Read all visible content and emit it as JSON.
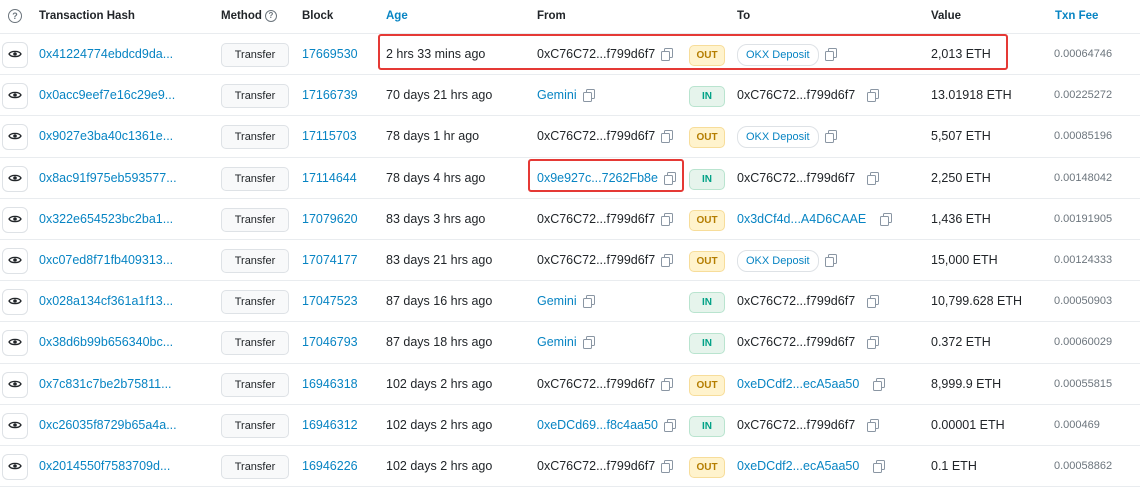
{
  "header": {
    "columns": {
      "hash": "Transaction Hash",
      "method": "Method",
      "block": "Block",
      "age": "Age",
      "from": "From",
      "to": "To",
      "value": "Value",
      "fee": "Txn Fee"
    },
    "help_glyph": "?"
  },
  "icons": {
    "view": "eye-icon",
    "copy": "copy-icon",
    "help": "question-circle-icon"
  },
  "colors": {
    "link": "#0784c3",
    "out": "#b47d00",
    "in": "#00a186",
    "highlight": "#e53935"
  },
  "rows": [
    {
      "hash": "0x41224774ebdcd9da...",
      "method": "Transfer",
      "block": "17669530",
      "age": "2 hrs 33 mins ago",
      "from": "0xC76C72...f799d6f7",
      "from_link": false,
      "dir": "OUT",
      "to": "OKX Deposit",
      "to_type": "pill",
      "value": "2,013 ETH",
      "fee": "0.00064746"
    },
    {
      "hash": "0x0acc9eef7e16c29e9...",
      "method": "Transfer",
      "block": "17166739",
      "age": "70 days 21 hrs ago",
      "from": "Gemini",
      "from_link": true,
      "dir": "IN",
      "to": "0xC76C72...f799d6f7",
      "to_type": "plain",
      "value": "13.01918 ETH",
      "fee": "0.00225272"
    },
    {
      "hash": "0x9027e3ba40c1361e...",
      "method": "Transfer",
      "block": "17115703",
      "age": "78 days 1 hr ago",
      "from": "0xC76C72...f799d6f7",
      "from_link": false,
      "dir": "OUT",
      "to": "OKX Deposit",
      "to_type": "pill",
      "value": "5,507 ETH",
      "fee": "0.00085196"
    },
    {
      "hash": "0x8ac91f975eb593577...",
      "method": "Transfer",
      "block": "17114644",
      "age": "78 days 4 hrs ago",
      "from": "0x9e927c...7262Fb8e",
      "from_link": true,
      "dir": "IN",
      "to": "0xC76C72...f799d6f7",
      "to_type": "plain",
      "value": "2,250 ETH",
      "fee": "0.00148042"
    },
    {
      "hash": "0x322e654523bc2ba1...",
      "method": "Transfer",
      "block": "17079620",
      "age": "83 days 3 hrs ago",
      "from": "0xC76C72...f799d6f7",
      "from_link": false,
      "dir": "OUT",
      "to": "0x3dCf4d...A4D6CAAE",
      "to_type": "link",
      "value": "1,436 ETH",
      "fee": "0.00191905"
    },
    {
      "hash": "0xc07ed8f71fb409313...",
      "method": "Transfer",
      "block": "17074177",
      "age": "83 days 21 hrs ago",
      "from": "0xC76C72...f799d6f7",
      "from_link": false,
      "dir": "OUT",
      "to": "OKX Deposit",
      "to_type": "pill",
      "value": "15,000 ETH",
      "fee": "0.00124333"
    },
    {
      "hash": "0x028a134cf361a1f13...",
      "method": "Transfer",
      "block": "17047523",
      "age": "87 days 16 hrs ago",
      "from": "Gemini",
      "from_link": true,
      "dir": "IN",
      "to": "0xC76C72...f799d6f7",
      "to_type": "plain",
      "value": "10,799.628 ETH",
      "fee": "0.00050903"
    },
    {
      "hash": "0x38d6b99b656340bc...",
      "method": "Transfer",
      "block": "17046793",
      "age": "87 days 18 hrs ago",
      "from": "Gemini",
      "from_link": true,
      "dir": "IN",
      "to": "0xC76C72...f799d6f7",
      "to_type": "plain",
      "value": "0.372 ETH",
      "fee": "0.00060029"
    },
    {
      "hash": "0x7c831c7be2b75811...",
      "method": "Transfer",
      "block": "16946318",
      "age": "102 days 2 hrs ago",
      "from": "0xC76C72...f799d6f7",
      "from_link": false,
      "dir": "OUT",
      "to": "0xeDCdf2...ecA5aa50",
      "to_type": "link",
      "value": "8,999.9 ETH",
      "fee": "0.00055815"
    },
    {
      "hash": "0xc26035f8729b65a4a...",
      "method": "Transfer",
      "block": "16946312",
      "age": "102 days 2 hrs ago",
      "from": "0xeDCd69...f8c4aa50",
      "from_link": true,
      "dir": "IN",
      "to": "0xC76C72...f799d6f7",
      "to_type": "plain",
      "value": "0.00001 ETH",
      "fee": "0.000469"
    },
    {
      "hash": "0x2014550f7583709d...",
      "method": "Transfer",
      "block": "16946226",
      "age": "102 days 2 hrs ago",
      "from": "0xC76C72...f799d6f7",
      "from_link": false,
      "dir": "OUT",
      "to": "0xeDCdf2...ecA5aa50",
      "to_type": "link",
      "value": "0.1 ETH",
      "fee": "0.00058862"
    }
  ]
}
